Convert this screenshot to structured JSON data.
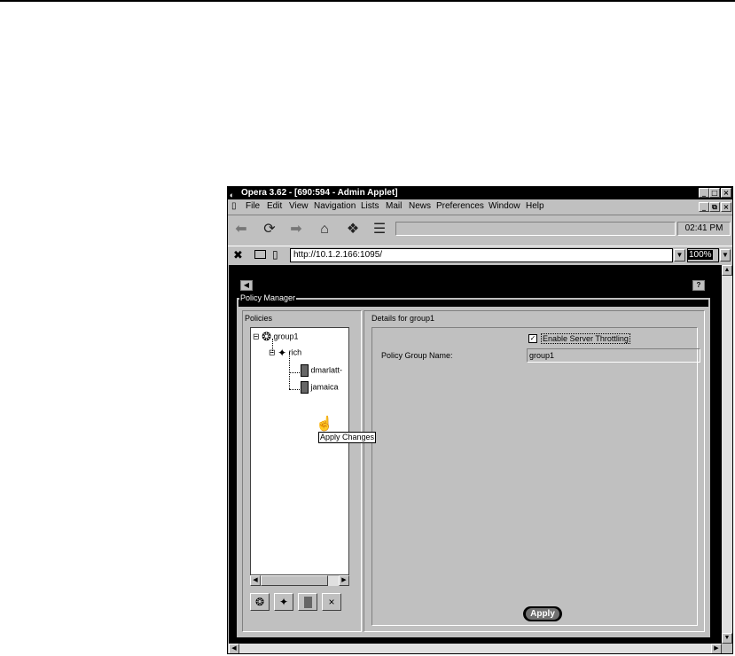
{
  "window": {
    "title": "Opera 3.62 - [690:594 - Admin Applet]",
    "title_icon": "opera-icon",
    "controls": [
      "_",
      "□",
      "×"
    ],
    "inner_controls": [
      "_",
      "⧉",
      "×"
    ]
  },
  "menu": {
    "items": [
      "File",
      "Edit",
      "View",
      "Navigation",
      "Lists",
      "Mail",
      "News",
      "Preferences",
      "Window",
      "Help"
    ]
  },
  "toolbar": {
    "buttons": [
      "back-icon",
      "reload-icon",
      "forward-icon",
      "home-icon",
      "hotlist-icon",
      "print-icon"
    ],
    "clock": "02:41 PM"
  },
  "address": {
    "url": "http://10.1.2.166:1095/",
    "zoom": "100%"
  },
  "applet": {
    "panel_title": "Policy Manager",
    "policies_label": "Policies",
    "tree": [
      {
        "label": "group1",
        "toggle": "⊟",
        "icon": "group-icon",
        "level": 0
      },
      {
        "label": "rich",
        "toggle": "⊟",
        "icon": "user-icon",
        "level": 1
      },
      {
        "label": "dmarlatt-",
        "icon": "server-icon",
        "level": 2
      },
      {
        "label": "jamaica",
        "icon": "server-icon",
        "level": 2
      }
    ],
    "policy_buttons": [
      "add-group-icon",
      "add-user-icon",
      "add-server-icon",
      "delete-icon"
    ],
    "details_label": "Details for group1",
    "throttling_label": "Enable Server Throttling",
    "throttling_checked": true,
    "group_name_label": "Policy Group Name:",
    "group_name_value": "group1",
    "apply_label": "Apply",
    "tooltip": "Apply Changes"
  }
}
